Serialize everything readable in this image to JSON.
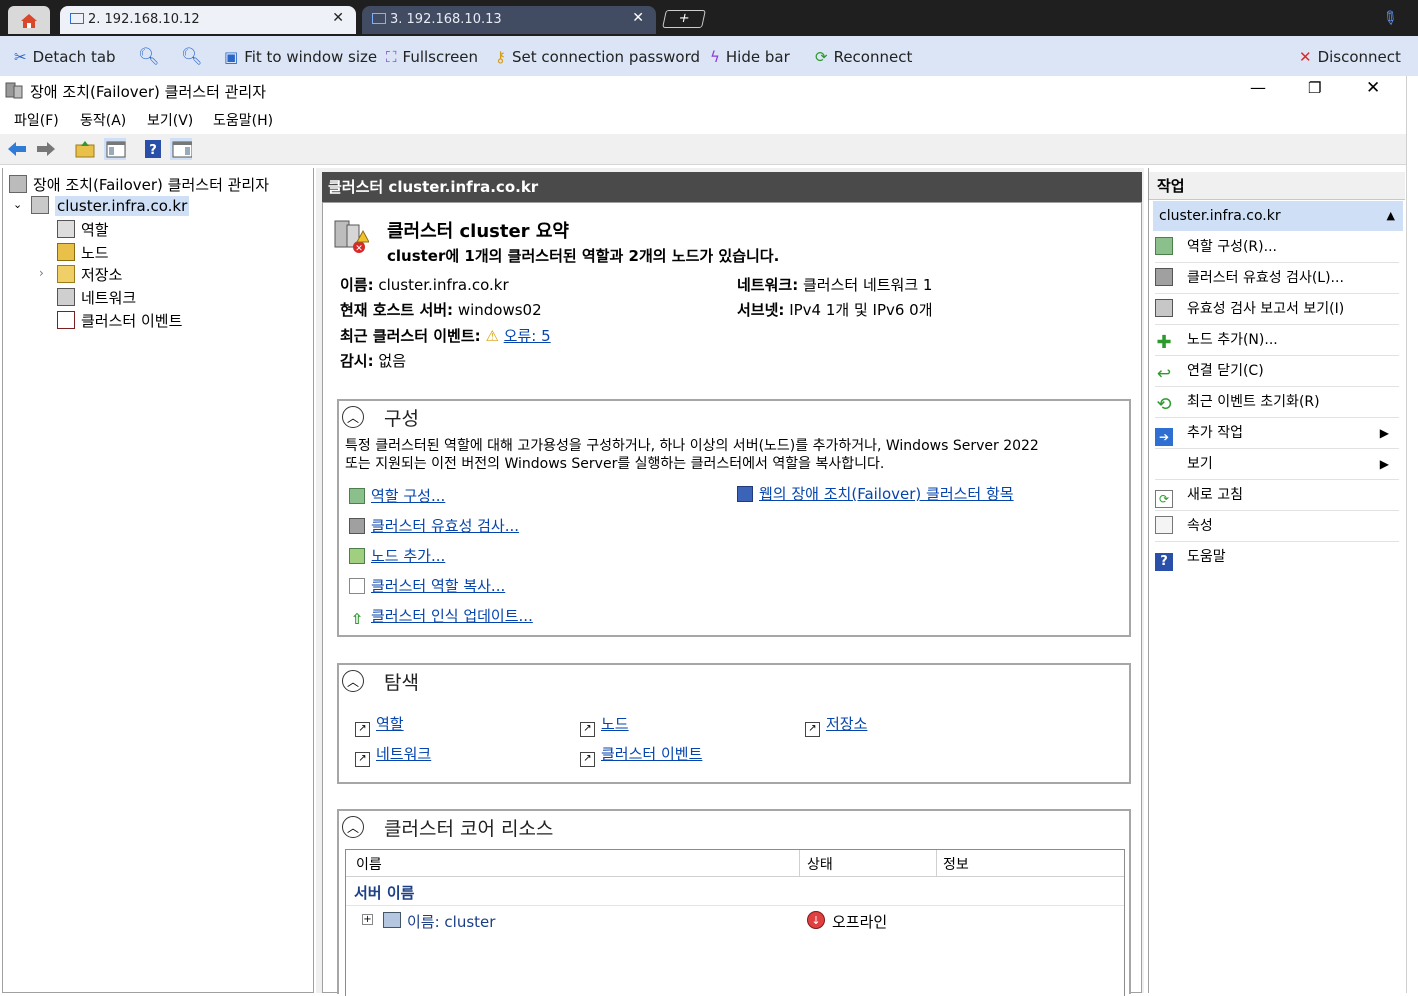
{
  "tabs": [
    {
      "label": "2. 192.168.10.12",
      "active": true
    },
    {
      "label": "3. 192.168.10.13",
      "active": false
    }
  ],
  "remote_toolbar": {
    "detach": "Detach tab",
    "fit": "Fit to window size",
    "fullscreen": "Fullscreen",
    "set_password": "Set connection password",
    "hide_bar": "Hide bar",
    "reconnect": "Reconnect",
    "disconnect": "Disconnect"
  },
  "window": {
    "title": "장애 조치(Failover) 클러스터 관리자",
    "menu": [
      "파일(F)",
      "동작(A)",
      "보기(V)",
      "도움말(H)"
    ]
  },
  "tree": {
    "root": "장애 조치(Failover) 클러스터 관리자",
    "cluster": "cluster.infra.co.kr",
    "children": [
      "역할",
      "노드",
      "저장소",
      "네트워크",
      "클러스터 이벤트"
    ]
  },
  "center": {
    "header": "클러스터 cluster.infra.co.kr",
    "summary_title": "클러스터 cluster 요약",
    "summary_sub": "cluster에 1개의 클러스터된 역할과 2개의 노드가 있습니다.",
    "info": {
      "name_label": "이름:",
      "name_value": "cluster.infra.co.kr",
      "network_label": "네트워크:",
      "network_value": "클러스터 네트워크 1",
      "host_label": "현재 호스트 서버:",
      "host_value": "windows02",
      "subnet_label": "서브넷:",
      "subnet_value": "IPv4 1개 및 IPv6 0개",
      "events_label": "최근 클러스터 이벤트:",
      "events_value": "오류: 5",
      "witness_label": "감시:",
      "witness_value": "없음"
    },
    "config": {
      "title": "구성",
      "desc_line1": "특정 클러스터된 역할에 대해 고가용성을 구성하거나, 하나 이상의 서버(노드)를 추가하거나, Windows Server 2022",
      "desc_line2": "또는 지원되는 이전 버전의 Windows Server를 실행하는 클러스터에서 역할을 복사합니다.",
      "links": [
        "역할 구성...",
        "클러스터 유효성 검사...",
        "노드 추가...",
        "클러스터 역할 복사...",
        "클러스터 인식 업데이트..."
      ],
      "web_link": "웹의 장애 조치(Failover) 클러스터 항목"
    },
    "navigate": {
      "title": "탐색",
      "links": [
        "역할",
        "노드",
        "저장소",
        "네트워크",
        "클러스터 이벤트"
      ]
    },
    "core": {
      "title": "클러스터 코어 리소스",
      "columns": [
        "이름",
        "상태",
        "정보"
      ],
      "group": "서버 이름",
      "row": {
        "name": "이름: cluster",
        "status": "오프라인"
      }
    }
  },
  "actions": {
    "header": "작업",
    "group": "cluster.infra.co.kr",
    "items": [
      "역할 구성(R)...",
      "클러스터 유효성 검사(L)...",
      "유효성 검사 보고서 보기(I)",
      "노드 추가(N)...",
      "연결 닫기(C)",
      "최근 이벤트 초기화(R)",
      "추가 작업",
      "보기",
      "새로 고침",
      "속성",
      "도움말"
    ]
  },
  "colors": {
    "tab_bar": "#1f1f1f",
    "remote_toolbar": "#dbe5f6",
    "center_header": "#4a4a4a",
    "actions_group": "#cfe0f6",
    "link": "#0645ad"
  }
}
